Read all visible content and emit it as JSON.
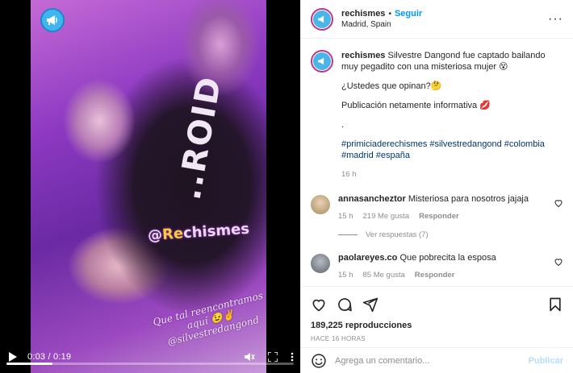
{
  "post": {
    "username": "rechismes",
    "follow_label": "Seguir",
    "separator": "•",
    "location": "Madrid, Spain",
    "more_label": "···",
    "avatar_icon": "megaphone-icon"
  },
  "video": {
    "watermark_prefix": "@",
    "watermark_highlight": "Re",
    "watermark_rest": "chismes",
    "shirt_text": "..ROID",
    "overlay_caption": "Que tal reencontramos aquí 😉✌ @silvestredangond",
    "current_time": "0:03",
    "duration": "0:19",
    "time_separator": " / ",
    "progress": 0.16,
    "play_icon": "play-icon",
    "mute_icon": "mute-icon",
    "fullscreen_icon": "fullscreen-icon"
  },
  "caption": {
    "username": "rechismes",
    "text": "Silvestre Dangond fue captado bailando muy pegadito con una misteriosa mujer 😵",
    "question": "¿Ustedes que opinan?🤔",
    "note": "Publicación netamente informativa 💋",
    "dot": ".",
    "hashtags": "#primiciaderechismes #silvestredangond #colombia #madrid #españa",
    "time": "16 h"
  },
  "comments": [
    {
      "username": "annasancheztor",
      "text": "Misteriosa para nosotros jajaja",
      "time": "15 h",
      "likes": "219 Me gusta",
      "reply": "Responder",
      "replies_label": "Ver respuestas (7)",
      "avatar_color": "#c9b08a"
    },
    {
      "username": "paolareyes.co",
      "text": "Que pobrecita la esposa",
      "time": "15 h",
      "likes": "85 Me gusta",
      "reply": "Responder",
      "avatar_color": "#8a8f99"
    }
  ],
  "actions": {
    "like_icon": "heart-icon",
    "comment_icon": "comment-icon",
    "share_icon": "share-icon",
    "save_icon": "bookmark-icon",
    "views": "189,225 reproducciones",
    "date": "HACE 16 HORAS"
  },
  "add_comment": {
    "placeholder": "Agrega un comentario...",
    "publish_label": "Publicar",
    "emoji_icon": "emoji-icon"
  },
  "colors": {
    "accent": "#0095f6",
    "link": "#00376b",
    "muted": "#8e8e8e",
    "publish_disabled": "#b2dffc"
  }
}
